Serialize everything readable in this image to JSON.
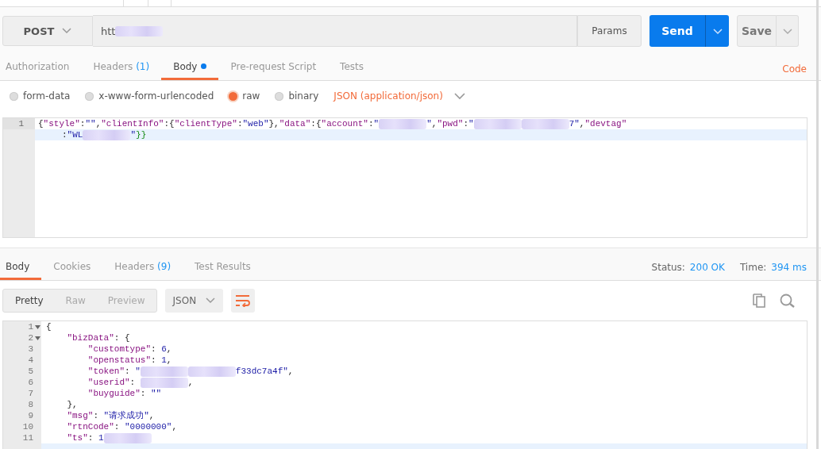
{
  "request": {
    "method": "POST",
    "url": "htt",
    "url_redacted": true,
    "params_button": "Params",
    "send_button": "Send",
    "save_button": "Save"
  },
  "request_tabs": [
    {
      "label": "Authorization",
      "selected": false
    },
    {
      "label": "Headers",
      "count": "(1)",
      "selected": false
    },
    {
      "label": "Body",
      "selected": true,
      "modified": true
    },
    {
      "label": "Pre-request Script",
      "selected": false
    },
    {
      "label": "Tests",
      "selected": false
    }
  ],
  "code_link": "Code",
  "body_types": [
    {
      "label": "form-data",
      "selected": false
    },
    {
      "label": "x-www-form-urlencoded",
      "selected": false
    },
    {
      "label": "raw",
      "selected": true
    },
    {
      "label": "binary",
      "selected": false
    }
  ],
  "content_type": "JSON (application/json)",
  "request_body": [
    {
      "number": "1",
      "active": false,
      "tokens": [
        {
          "kind": "punct",
          "text": "{"
        },
        {
          "kind": "key",
          "text": "\"style\""
        },
        {
          "kind": "punct",
          "text": ":"
        },
        {
          "kind": "str",
          "text": "\"\""
        },
        {
          "kind": "punct",
          "text": ","
        },
        {
          "kind": "key",
          "text": "\"clientInfo\""
        },
        {
          "kind": "punct",
          "text": ":{"
        },
        {
          "kind": "key",
          "text": "\"clientType\""
        },
        {
          "kind": "punct",
          "text": ":"
        },
        {
          "kind": "str",
          "text": "\"web\""
        },
        {
          "kind": "punct",
          "text": "},"
        },
        {
          "kind": "key",
          "text": "\"data\""
        },
        {
          "kind": "punct",
          "text": ":{"
        },
        {
          "kind": "key",
          "text": "\"account\""
        },
        {
          "kind": "punct",
          "text": ":"
        },
        {
          "kind": "str",
          "text": "\""
        },
        {
          "kind": "redacted"
        },
        {
          "kind": "str",
          "text": "\""
        },
        {
          "kind": "punct",
          "text": ","
        },
        {
          "kind": "key",
          "text": "\"pwd\""
        },
        {
          "kind": "punct",
          "text": ":"
        },
        {
          "kind": "str",
          "text": "\""
        },
        {
          "kind": "redacted"
        },
        {
          "kind": "redacted"
        },
        {
          "kind": "str",
          "text": "7\""
        },
        {
          "kind": "punct",
          "text": ","
        },
        {
          "kind": "key",
          "text": "\"devtag\""
        }
      ]
    },
    {
      "active": true,
      "tokens": [
        {
          "kind": "punct",
          "text": ":"
        },
        {
          "kind": "str",
          "text": "\"WL"
        },
        {
          "kind": "redacted"
        },
        {
          "kind": "str",
          "text": "\""
        },
        {
          "kind": "brace",
          "text": "}}"
        }
      ]
    }
  ],
  "response_tabs": [
    {
      "label": "Body",
      "selected": true
    },
    {
      "label": "Cookies",
      "selected": false
    },
    {
      "label": "Headers",
      "count": "(9)",
      "selected": false
    },
    {
      "label": "Test Results",
      "selected": false
    }
  ],
  "status": {
    "label": "Status:",
    "value": "200 OK"
  },
  "time": {
    "label": "Time:",
    "value": "394 ms"
  },
  "view_modes": [
    {
      "label": "Pretty",
      "selected": true
    },
    {
      "label": "Raw",
      "selected": false
    },
    {
      "label": "Preview",
      "selected": false
    }
  ],
  "format": "JSON",
  "response_body": [
    {
      "number": "1",
      "tokens": [
        {
          "kind": "punct",
          "text": "{"
        }
      ],
      "children": [
        {
          "number": "2",
          "tokens": [
            {
              "kind": "key",
              "text": "\"bizData\""
            },
            {
              "kind": "punct",
              "text": ": {"
            }
          ],
          "children": [
            {
              "number": "3",
              "tokens": [
                {
                  "kind": "key",
                  "text": "\"customtype\""
                },
                {
                  "kind": "punct",
                  "text": ": "
                },
                {
                  "kind": "num",
                  "text": "6"
                },
                {
                  "kind": "punct",
                  "text": ","
                }
              ]
            },
            {
              "number": "4",
              "tokens": [
                {
                  "kind": "key",
                  "text": "\"openstatus\""
                },
                {
                  "kind": "punct",
                  "text": ": "
                },
                {
                  "kind": "num",
                  "text": "1"
                },
                {
                  "kind": "punct",
                  "text": ","
                }
              ]
            },
            {
              "number": "5",
              "tokens": [
                {
                  "kind": "key",
                  "text": "\"token\""
                },
                {
                  "kind": "punct",
                  "text": ": "
                },
                {
                  "kind": "str",
                  "text": "\""
                },
                {
                  "kind": "redacted"
                },
                {
                  "kind": "redacted"
                },
                {
                  "kind": "str",
                  "text": "f33dc7a4f\""
                },
                {
                  "kind": "punct",
                  "text": ","
                }
              ]
            },
            {
              "number": "6",
              "tokens": [
                {
                  "kind": "key",
                  "text": "\"userid\""
                },
                {
                  "kind": "punct",
                  "text": ": "
                },
                {
                  "kind": "redacted"
                },
                {
                  "kind": "punct",
                  "text": ","
                }
              ]
            },
            {
              "number": "7",
              "tokens": [
                {
                  "kind": "key",
                  "text": "\"buyguide\""
                },
                {
                  "kind": "punct",
                  "text": ": "
                },
                {
                  "kind": "str",
                  "text": "\"\""
                }
              ]
            }
          ]
        },
        {
          "number": "8",
          "tokens": [
            {
              "kind": "punct",
              "text": "},"
            }
          ]
        },
        {
          "number": "9",
          "tokens": [
            {
              "kind": "key",
              "text": "\"msg\""
            },
            {
              "kind": "punct",
              "text": ": "
            },
            {
              "kind": "str",
              "text": "\"请求成功\""
            },
            {
              "kind": "punct",
              "text": ","
            }
          ]
        },
        {
          "number": "10",
          "tokens": [
            {
              "kind": "key",
              "text": "\"rtnCode\""
            },
            {
              "kind": "punct",
              "text": ": "
            },
            {
              "kind": "str",
              "text": "\"0000000\""
            },
            {
              "kind": "punct",
              "text": ","
            }
          ]
        },
        {
          "number": "11",
          "tokens": [
            {
              "kind": "key",
              "text": "\"ts\""
            },
            {
              "kind": "punct",
              "text": ": "
            },
            {
              "kind": "num",
              "text": "1"
            },
            {
              "kind": "redacted"
            }
          ]
        }
      ]
    }
  ]
}
